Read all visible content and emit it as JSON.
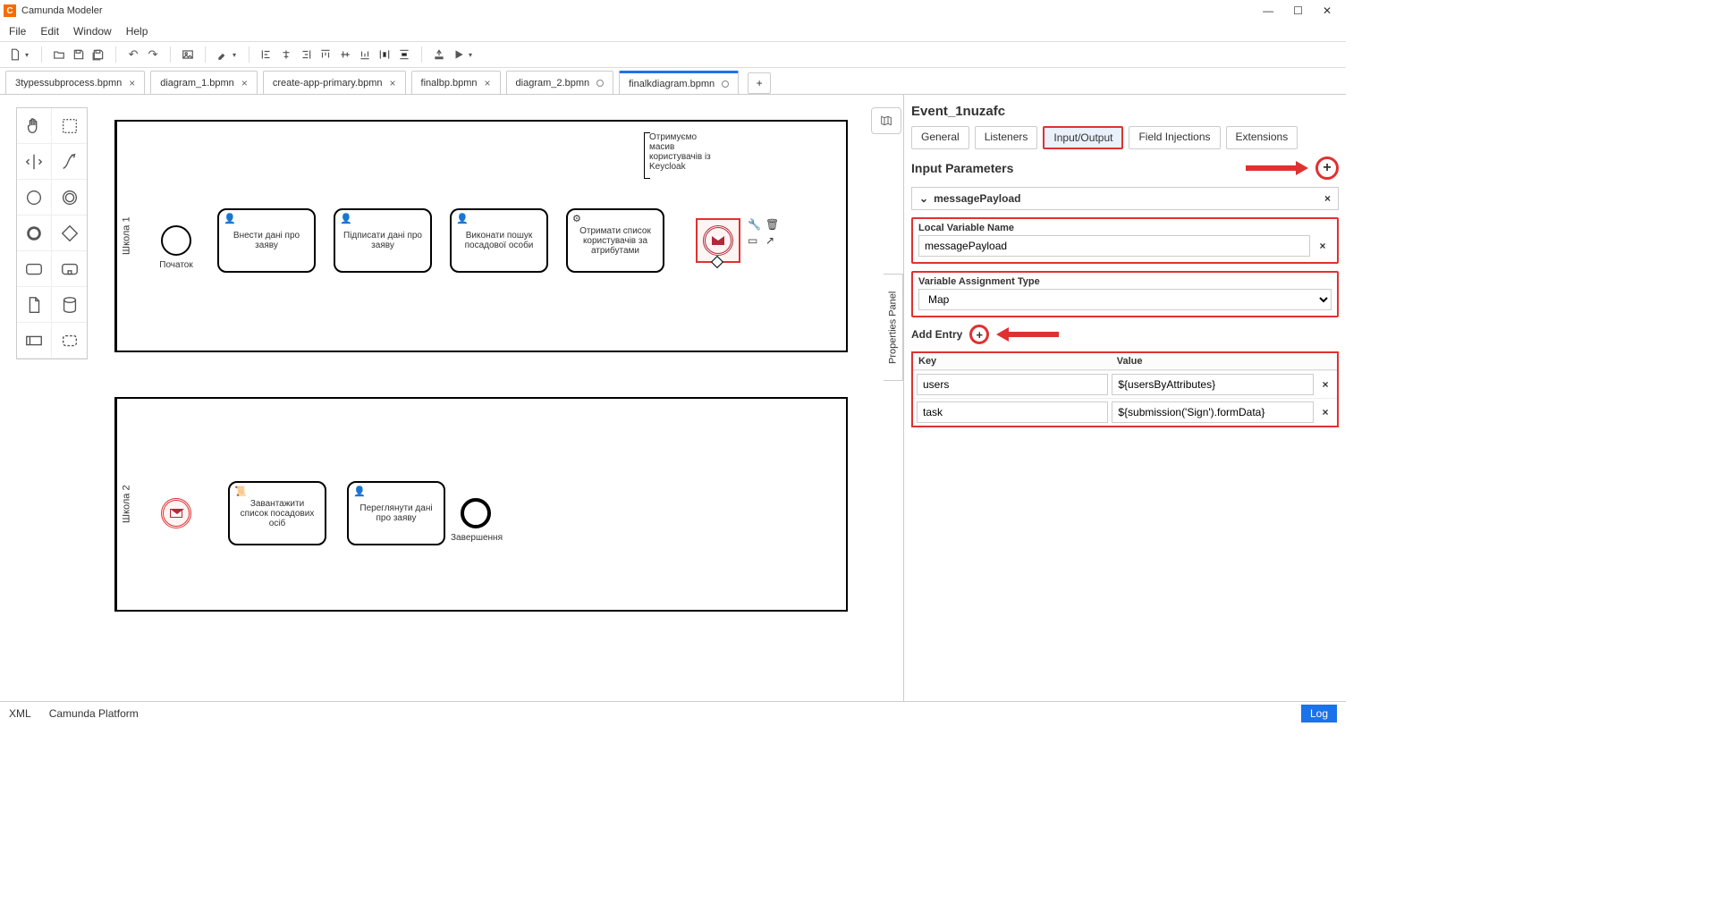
{
  "app": {
    "title": "Camunda Modeler"
  },
  "menu": [
    "File",
    "Edit",
    "Window",
    "Help"
  ],
  "tabs": [
    {
      "label": "3typessubprocess.bpmn",
      "dirty": false
    },
    {
      "label": "diagram_1.bpmn",
      "dirty": false
    },
    {
      "label": "create-app-primary.bpmn",
      "dirty": false
    },
    {
      "label": "finalbp.bpmn",
      "dirty": false
    },
    {
      "label": "diagram_2.bpmn",
      "dirty": true
    },
    {
      "label": "finalkdiagram.bpmn",
      "dirty": true,
      "active": true
    }
  ],
  "diagram": {
    "pools": [
      {
        "lane_label": "Школа 1",
        "start_label": "Початок",
        "tasks": [
          {
            "text": "Внести дані про заяву",
            "decor": "user"
          },
          {
            "text": "Підписати дані про заяву",
            "decor": "user"
          },
          {
            "text": "Виконати пошук посадової особи",
            "decor": "user"
          },
          {
            "text": "Отримати список користувачів за атрибутами",
            "decor": "service"
          }
        ],
        "annotation": "Отримуємо масив користувачів із Keycloak"
      },
      {
        "lane_label": "Школа 2",
        "tasks": [
          {
            "text": "Завантажити список посадових осіб",
            "decor": "script"
          },
          {
            "text": "Переглянути дані про заяву",
            "decor": "user"
          }
        ],
        "end_label": "Завершення"
      }
    ]
  },
  "props": {
    "element_id": "Event_1nuzafc",
    "tabs": [
      "General",
      "Listeners",
      "Input/Output",
      "Field Injections",
      "Extensions"
    ],
    "active_tab": "Input/Output",
    "section": "Input Parameters",
    "param_name": "messagePayload",
    "local_var_label": "Local Variable Name",
    "local_var_value": "messagePayload",
    "assign_type_label": "Variable Assignment Type",
    "assign_type_value": "Map",
    "add_entry_label": "Add Entry",
    "kv_headers": {
      "key": "Key",
      "value": "Value"
    },
    "entries": [
      {
        "key": "users",
        "value": "${usersByAttributes}"
      },
      {
        "key": "task",
        "value": "${submission('Sign').formData}"
      }
    ]
  },
  "status": {
    "left1": "XML",
    "left2": "Camunda Platform",
    "log": "Log"
  },
  "props_panel_label": "Properties Panel"
}
